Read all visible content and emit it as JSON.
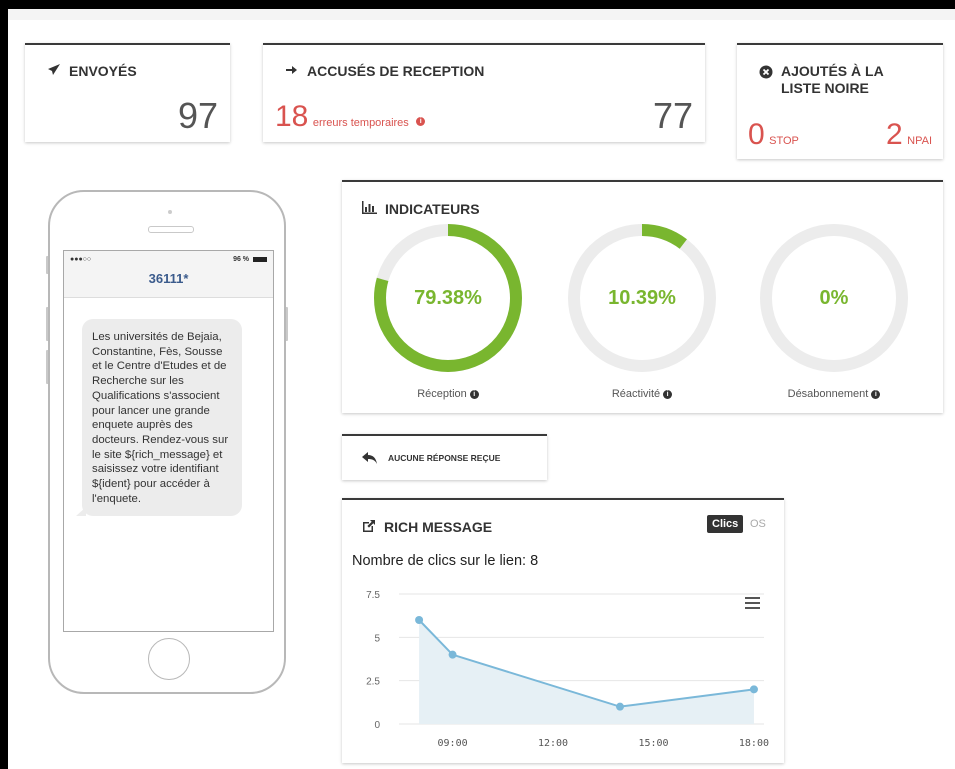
{
  "stats": {
    "sent": {
      "title": "ENVOYÉS",
      "value": "97"
    },
    "received": {
      "title": "ACCUSÉS DE RECEPTION",
      "value": "77",
      "errors_count": "18",
      "errors_label": "erreurs temporaires"
    },
    "blacklist": {
      "title_line1": "AJOUTÉS À LA",
      "title_line2": "LISTE NOIRE",
      "stop_count": "0",
      "stop_label": "STOP",
      "npai_count": "2",
      "npai_label": "NPAI"
    }
  },
  "phone": {
    "signal": "●●●○○",
    "battery": "96 %",
    "number": "36111*",
    "message": "Les universités de Bejaia, Constantine, Fès, Sousse et le Centre d'Etudes et de Recherche sur les Qualifications s'associent pour lancer une grande enquete auprès des docteurs. Rendez-vous sur le site ${rich_message} et saisissez votre identifiant ${ident} pour accéder à l'enquete."
  },
  "indicators": {
    "title": "INDICATEURS",
    "items": [
      {
        "value": "79.38%",
        "fraction": 0.7938,
        "label": "Réception"
      },
      {
        "value": "10.39%",
        "fraction": 0.1039,
        "label": "Réactivité"
      },
      {
        "value": "0%",
        "fraction": 0.0,
        "label": "Désabonnement"
      }
    ],
    "accent": "#79b62f",
    "track": "#ececec"
  },
  "responses": {
    "label": "AUCUNE RÉPONSE REÇUE"
  },
  "rich": {
    "title": "RICH MESSAGE",
    "tab_active": "Clics",
    "tab_inactive": "OS",
    "clicks_label": "Nombre de clics sur le lien: 8"
  },
  "chart_data": {
    "type": "area",
    "x": [
      "08:00",
      "09:00",
      "14:00",
      "18:00"
    ],
    "x_numeric": [
      8,
      9,
      14,
      18
    ],
    "y": [
      6,
      4,
      1,
      2
    ],
    "xticks": [
      "09:00",
      "12:00",
      "15:00",
      "18:00"
    ],
    "xticks_numeric": [
      9,
      12,
      15,
      18
    ],
    "yticks": [
      "0",
      "2.5",
      "5",
      "7.5"
    ],
    "ylim": [
      0,
      7.5
    ],
    "xlim": [
      8,
      18
    ],
    "line_color": "#7ab8d9",
    "fill_color": "#e6f0f5",
    "grid": true
  }
}
